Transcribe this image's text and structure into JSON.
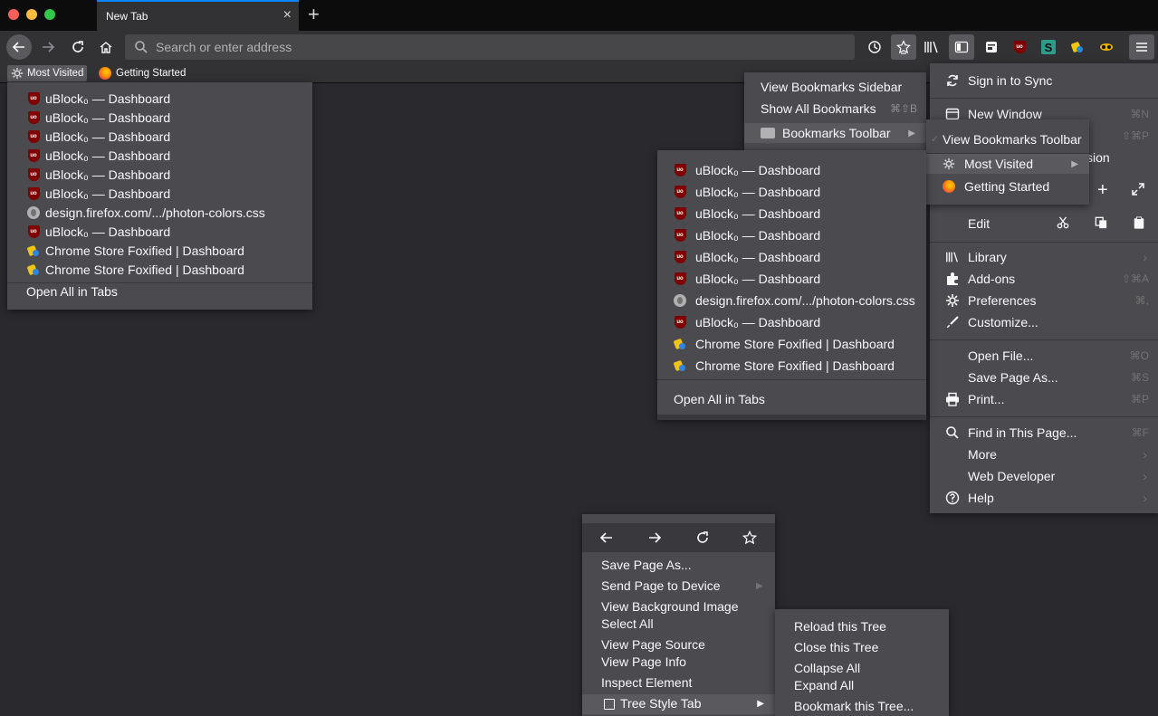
{
  "colors": {
    "accent": "#0a84ff",
    "menu_bg": "#4a4a4f",
    "toolbar_bg": "#323234",
    "content_bg": "#2a2a2e",
    "ublock_red": "#800000"
  },
  "window": {
    "traffic_lights": [
      "close",
      "minimize",
      "zoom"
    ],
    "tab": {
      "title": "New Tab",
      "close": "×"
    },
    "new_tab_label": "+"
  },
  "navbar": {
    "search_placeholder": "Search or enter address"
  },
  "bookmarks_toolbar": {
    "items": [
      {
        "label": "Most Visited",
        "icon": "gear-icon"
      },
      {
        "label": "Getting Started",
        "icon": "firefox-icon"
      }
    ]
  },
  "most_visited_menu": {
    "items": [
      {
        "label": "uBlock₀ — Dashboard",
        "icon": "ublock-icon"
      },
      {
        "label": "uBlock₀ — Dashboard",
        "icon": "ublock-icon"
      },
      {
        "label": "uBlock₀ — Dashboard",
        "icon": "ublock-icon"
      },
      {
        "label": "uBlock₀ — Dashboard",
        "icon": "ublock-icon"
      },
      {
        "label": "uBlock₀ — Dashboard",
        "icon": "ublock-icon"
      },
      {
        "label": "uBlock₀ — Dashboard",
        "icon": "ublock-icon"
      },
      {
        "label": "design.firefox.com/.../photon-colors.css",
        "icon": "globe-icon"
      },
      {
        "label": "uBlock₀ — Dashboard",
        "icon": "ublock-icon"
      },
      {
        "label": "Chrome Store Foxified | Dashboard",
        "icon": "chrome-store-foxified-icon"
      },
      {
        "label": "Chrome Store Foxified | Dashboard",
        "icon": "chrome-store-foxified-icon"
      }
    ],
    "open_all": "Open All in Tabs"
  },
  "bookmarks_menu": {
    "view_sidebar": "View Bookmarks Sidebar",
    "show_all": "Show All Bookmarks",
    "show_all_shortcut": "⌘⇧B",
    "toolbar_label": "Bookmarks Toolbar"
  },
  "bookmarks_toolbar_submenu": {
    "view_toolbar": "View Bookmarks Toolbar",
    "most_visited": "Most Visited",
    "getting_started": "Getting Started"
  },
  "most_visited_submenu": {
    "items": [
      {
        "label": "uBlock₀ — Dashboard",
        "icon": "ublock-icon"
      },
      {
        "label": "uBlock₀ — Dashboard",
        "icon": "ublock-icon"
      },
      {
        "label": "uBlock₀ — Dashboard",
        "icon": "ublock-icon"
      },
      {
        "label": "uBlock₀ — Dashboard",
        "icon": "ublock-icon"
      },
      {
        "label": "uBlock₀ — Dashboard",
        "icon": "ublock-icon"
      },
      {
        "label": "uBlock₀ — Dashboard",
        "icon": "ublock-icon"
      },
      {
        "label": "design.firefox.com/.../photon-colors.css",
        "icon": "globe-icon"
      },
      {
        "label": "uBlock₀ — Dashboard",
        "icon": "ublock-icon"
      },
      {
        "label": "Chrome Store Foxified | Dashboard",
        "icon": "chrome-store-foxified-icon"
      },
      {
        "label": "Chrome Store Foxified | Dashboard",
        "icon": "chrome-store-foxified-icon"
      }
    ],
    "open_all": "Open All in Tabs"
  },
  "hamburger_menu": {
    "sign_in": "Sign in to Sync",
    "new_window": "New Window",
    "new_window_shortcut": "⌘N",
    "private_shortcut": "⇧⌘P",
    "private_partial": "sion",
    "edit": "Edit",
    "library": "Library",
    "addons": "Add-ons",
    "addons_shortcut": "⇧⌘A",
    "preferences": "Preferences",
    "preferences_shortcut": "⌘,",
    "customize": "Customize...",
    "open_file": "Open File...",
    "open_file_shortcut": "⌘O",
    "save_page": "Save Page As...",
    "save_page_shortcut": "⌘S",
    "print": "Print...",
    "print_shortcut": "⌘P",
    "find": "Find in This Page...",
    "find_shortcut": "⌘F",
    "more": "More",
    "web_developer": "Web Developer",
    "help": "Help"
  },
  "context_menu": {
    "save_page": "Save Page As...",
    "send_page": "Send Page to Device",
    "view_bg_image": "View Background Image",
    "select_all": "Select All",
    "view_source": "View Page Source",
    "view_info": "View Page Info",
    "inspect": "Inspect Element",
    "tree_style_tab": "Tree Style Tab"
  },
  "tree_submenu": {
    "reload": "Reload this Tree",
    "close": "Close this Tree",
    "collapse": "Collapse All",
    "expand": "Expand All",
    "bookmark": "Bookmark this Tree..."
  }
}
